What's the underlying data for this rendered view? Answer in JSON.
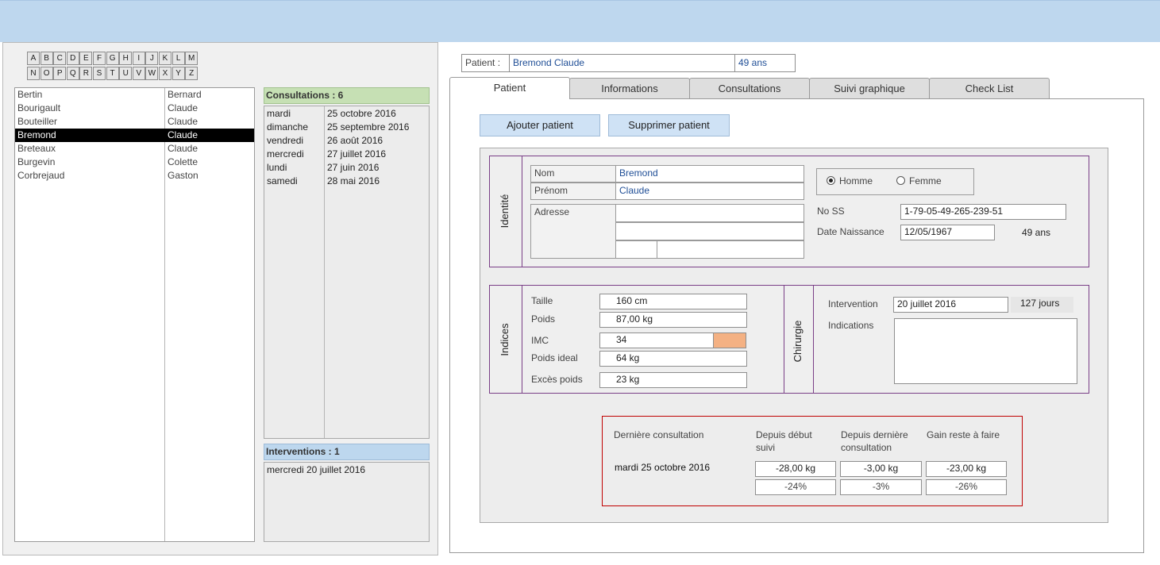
{
  "alphabet_row1": [
    "A",
    "B",
    "C",
    "D",
    "E",
    "F",
    "G",
    "H",
    "I",
    "J",
    "K",
    "L",
    "M"
  ],
  "alphabet_row2": [
    "N",
    "O",
    "P",
    "Q",
    "R",
    "S",
    "T",
    "U",
    "V",
    "W",
    "X",
    "Y",
    "Z"
  ],
  "patients": [
    {
      "last": "Bertin",
      "first": "Bernard"
    },
    {
      "last": "Bourigault",
      "first": "Claude"
    },
    {
      "last": "Bouteiller",
      "first": "Claude"
    },
    {
      "last": "Bremond",
      "first": "Claude"
    },
    {
      "last": "Breteaux",
      "first": "Claude"
    },
    {
      "last": "Burgevin",
      "first": "Colette"
    },
    {
      "last": "Corbrejaud",
      "first": "Gaston"
    }
  ],
  "consultations": {
    "header": "Consultations : 6",
    "rows": [
      {
        "day": "mardi",
        "date": "25 octobre 2016"
      },
      {
        "day": "dimanche",
        "date": "25 septembre 2016"
      },
      {
        "day": "vendredi",
        "date": "26 août 2016"
      },
      {
        "day": "mercredi",
        "date": "27 juillet 2016"
      },
      {
        "day": "lundi",
        "date": "27 juin 2016"
      },
      {
        "day": "samedi",
        "date": "28 mai 2016"
      }
    ]
  },
  "interventions": {
    "header": "Interventions : 1",
    "rows": [
      "mercredi 20 juillet 2016"
    ]
  },
  "patient_bar": {
    "label": "Patient :",
    "name": "Bremond Claude",
    "age": "49 ans"
  },
  "tabs": [
    "Patient",
    "Informations",
    "Consultations",
    "Suivi graphique",
    "Check List"
  ],
  "buttons": {
    "add": "Ajouter patient",
    "delete": "Supprimer patient"
  },
  "identity": {
    "section": "Identité",
    "nom_label": "Nom",
    "nom": "Bremond",
    "prenom_label": "Prénom",
    "prenom": "Claude",
    "adresse_label": "Adresse",
    "homme": "Homme",
    "femme": "Femme",
    "nss_label": "No SS",
    "nss": "1-79-05-49-265-239-51",
    "dob_label": "Date Naissance",
    "dob": "12/05/1967",
    "age": "49 ans"
  },
  "indices": {
    "section": "Indices",
    "taille_label": "Taille",
    "taille": "160 cm",
    "poids_label": "Poids",
    "poids": "87,00 kg",
    "imc_label": "IMC",
    "imc": "34",
    "poids_ideal_label": "Poids ideal",
    "poids_ideal": "64 kg",
    "exces_label": "Excès poids",
    "exces": "23 kg"
  },
  "chirurgie": {
    "section": "Chirurgie",
    "intervention_label": "Intervention",
    "intervention": "20 juillet 2016",
    "jours": "127 jours",
    "indications_label": "Indications"
  },
  "summary": {
    "last_label": "Dernière consultation",
    "last_value": "mardi 25 octobre 2016",
    "col1_l1": "Depuis début",
    "col1_l2": "suivi",
    "col2_l1": "Depuis dernière",
    "col2_l2": "consultation",
    "col3_l1": "Gain reste à faire",
    "col1_kg": "-28,00 kg",
    "col1_pct": "-24%",
    "col2_kg": "-3,00 kg",
    "col2_pct": "-3%",
    "col3_kg": "-23,00 kg",
    "col3_pct": "-26%"
  },
  "colors": {
    "imc_indicator": "#f4b183",
    "accent_border": "#7a3f87",
    "summary_border": "#c00000"
  }
}
